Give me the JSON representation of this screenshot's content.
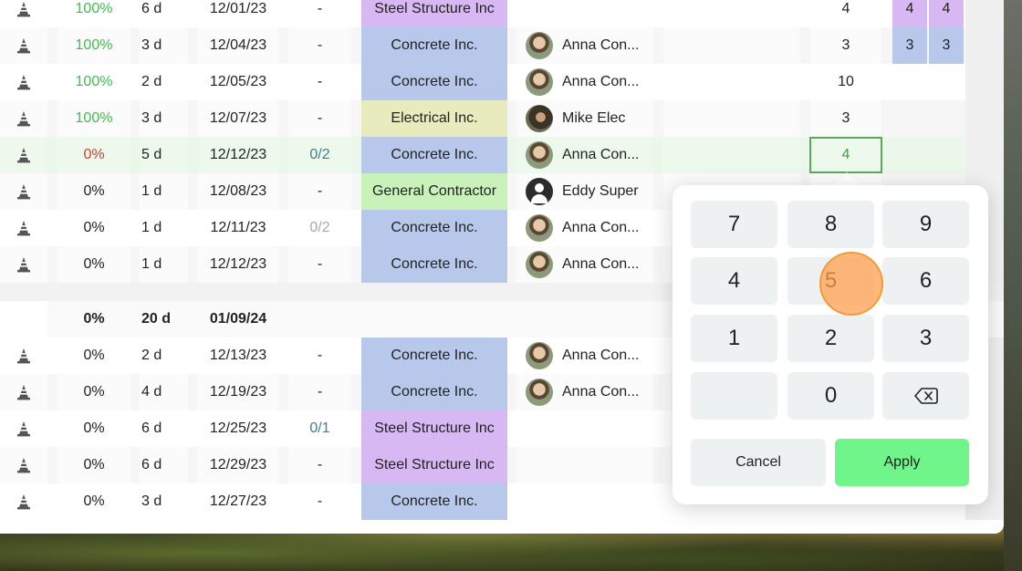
{
  "rows": [
    {
      "pct": "100%",
      "pct_color": "green",
      "dur": "6 d",
      "date": "12/01/23",
      "check": "-",
      "check_style": "",
      "company": "Steel Structure Inc",
      "company_color": "steel",
      "person": "",
      "avatar": "",
      "num": "4",
      "mini1": "4",
      "mini2": "4",
      "mini_color": "purple"
    },
    {
      "pct": "100%",
      "pct_color": "green",
      "dur": "3 d",
      "date": "12/04/23",
      "check": "-",
      "check_style": "",
      "company": "Concrete Inc.",
      "company_color": "concrete",
      "person": "Anna Con...",
      "avatar": "anna",
      "num": "3",
      "mini1": "3",
      "mini2": "3",
      "mini_color": "blue"
    },
    {
      "pct": "100%",
      "pct_color": "green",
      "dur": "2 d",
      "date": "12/05/23",
      "check": "-",
      "check_style": "",
      "company": "Concrete Inc.",
      "company_color": "concrete",
      "person": "Anna Con...",
      "avatar": "anna",
      "num": "10",
      "mini1": "",
      "mini2": "",
      "mini_color": ""
    },
    {
      "pct": "100%",
      "pct_color": "green",
      "dur": "3 d",
      "date": "12/07/23",
      "check": "-",
      "check_style": "",
      "company": "Electrical Inc.",
      "company_color": "electric",
      "person": "Mike Elec",
      "avatar": "mike",
      "num": "3",
      "mini1": "",
      "mini2": "",
      "mini_color": ""
    },
    {
      "pct": "0%",
      "pct_color": "red",
      "dur": "5 d",
      "date": "12/12/23",
      "check": "0/2",
      "check_style": "teal",
      "company": "Concrete Inc.",
      "company_color": "concrete",
      "person": "Anna Con...",
      "avatar": "anna",
      "num": "4",
      "mini1": "",
      "mini2": "",
      "mini_color": ""
    },
    {
      "pct": "0%",
      "pct_color": "",
      "dur": "1 d",
      "date": "12/08/23",
      "check": "-",
      "check_style": "",
      "company": "General Contractor",
      "company_color": "general",
      "person": "Eddy Super",
      "avatar": "generic",
      "num": "",
      "mini1": "",
      "mini2": "",
      "mini_color": ""
    },
    {
      "pct": "0%",
      "pct_color": "",
      "dur": "1 d",
      "date": "12/11/23",
      "check": "0/2",
      "check_style": "gray",
      "company": "Concrete Inc.",
      "company_color": "concrete",
      "person": "Anna Con...",
      "avatar": "anna",
      "num": "",
      "mini1": "",
      "mini2": "",
      "mini_color": ""
    },
    {
      "pct": "0%",
      "pct_color": "",
      "dur": "1 d",
      "date": "12/12/23",
      "check": "-",
      "check_style": "",
      "company": "Concrete Inc.",
      "company_color": "concrete",
      "person": "Anna Con...",
      "avatar": "anna",
      "num": "",
      "mini1": "",
      "mini2": "",
      "mini_color": ""
    }
  ],
  "group": {
    "pct": "0%",
    "dur": "20 d",
    "date": "01/09/24"
  },
  "rows2": [
    {
      "pct": "0%",
      "dur": "2 d",
      "date": "12/13/23",
      "check": "-",
      "check_style": "",
      "company": "Concrete Inc.",
      "company_color": "concrete",
      "person": "Anna Con...",
      "avatar": "anna"
    },
    {
      "pct": "0%",
      "dur": "4 d",
      "date": "12/19/23",
      "check": "-",
      "check_style": "",
      "company": "Concrete Inc.",
      "company_color": "concrete",
      "person": "Anna Con...",
      "avatar": "anna"
    },
    {
      "pct": "0%",
      "dur": "6 d",
      "date": "12/25/23",
      "check": "0/1",
      "check_style": "teal",
      "company": "Steel Structure Inc",
      "company_color": "steel",
      "person": "",
      "avatar": ""
    },
    {
      "pct": "0%",
      "dur": "6 d",
      "date": "12/29/23",
      "check": "-",
      "check_style": "",
      "company": "Steel Structure Inc",
      "company_color": "steel",
      "person": "",
      "avatar": ""
    },
    {
      "pct": "0%",
      "dur": "3 d",
      "date": "12/27/23",
      "check": "-",
      "check_style": "",
      "company": "Concrete Inc.",
      "company_color": "concrete",
      "person": "",
      "avatar": ""
    }
  ],
  "editor": {
    "value": "4"
  },
  "keypad": {
    "keys": [
      "7",
      "8",
      "9",
      "4",
      "5",
      "6",
      "1",
      "2",
      "3",
      "",
      "0"
    ],
    "backspace_icon": "backspace-icon",
    "cancel_label": "Cancel",
    "apply_label": "Apply"
  },
  "colors": {
    "accent_green": "#6ff58a",
    "pct_green": "#3fbf4b",
    "pct_red": "#d23a2a"
  }
}
